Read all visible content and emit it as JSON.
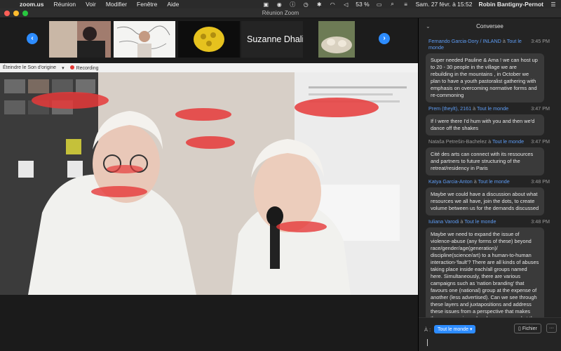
{
  "menubar": {
    "app": "zoom.us",
    "items": [
      "Réunion",
      "Voir",
      "Modifier",
      "Fenêtre",
      "Aide"
    ],
    "battery": "53 %",
    "datetime": "Sam. 27 févr. à 15:52",
    "user": "Robin Bantigny-Pernot"
  },
  "window": {
    "title": "Réunion Zoom"
  },
  "strip": {
    "participant_name": "Suzanne Dhali..."
  },
  "share_bar": {
    "audio_label": "Éteindre le Son d'origine",
    "recording_label": "Recording"
  },
  "chat": {
    "title": "Conversee",
    "messages": [
      {
        "sender": "Fernando Garcia-Dory / INLAND",
        "to": "Tout le monde",
        "time": "3:45 PM",
        "text": "Super needed Pauline & Ama !  we can host up to 20 - 30 people in the village we are rebuilding in the mountains , in October we plan to have a youth pastoralist gathering with emphasis on overcoming normative forms  and re-commoning"
      },
      {
        "sender": "Prem (theylt), 2161",
        "to": "Tout le monde",
        "time": "3:47 PM",
        "text": "If I were there I'd hum with you and then we'd dance off the shakes"
      },
      {
        "sender": "Nataša Petrešin-Bachelez",
        "to": "Tout le monde",
        "time": "3:47 PM",
        "text": "Cité des arts can connect with its ressources and partners to future structuring of the retreat/residency in Paris"
      },
      {
        "sender": "Katya Garcia-Anton",
        "to": "Tout le monde",
        "time": "3:48 PM",
        "text": "Maybe we could have a discussion about what resources we all have, join the dots, to create volume between us for the demands discussed"
      },
      {
        "sender": "Iuliana Varodi",
        "to": "Tout le monde",
        "time": "3:48 PM",
        "text": "Maybe we need to expand the issue of violence-abuse (any forms of these) beyond race/gender/age(generation)/ discipline(science/art) to a human-to-human interaction-'fault'? There are all kinds of abuses taking place inside each/all groups named here.  Simultaneously, there are various campaigns such as 'nation branding' that favours one (national) group at the expense of another (less advertised). Can we see through these layers and juxtapositions and address these issues from a perspective that makes them more universal and more personal at the same time?"
      }
    ],
    "to_prefix": "À :",
    "to_value": "Tout le monde",
    "file_label": "Fichier",
    "more_label": "···",
    "connector": "à"
  },
  "colors": {
    "accent": "#2d8cff",
    "sender": "#5e9cf4"
  }
}
